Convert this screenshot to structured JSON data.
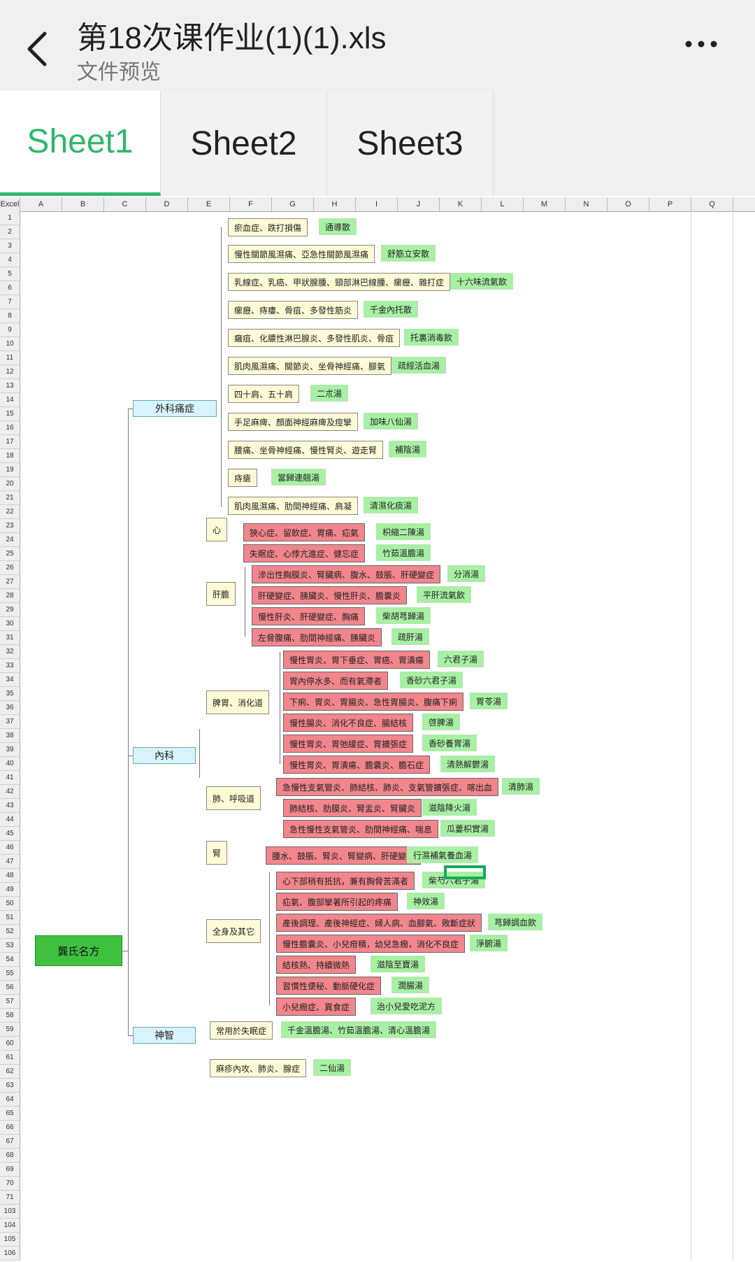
{
  "header": {
    "title": "第18次课作业(1)(1).xls",
    "subtitle": "文件预览"
  },
  "tabs": [
    "Sheet1",
    "Sheet2",
    "Sheet3"
  ],
  "active_tab": 0,
  "grid": {
    "corner": "Excel",
    "columns": [
      "A",
      "B",
      "C",
      "D",
      "E",
      "F",
      "G",
      "H",
      "I",
      "J",
      "K",
      "L",
      "M",
      "N",
      "O",
      "P",
      "Q"
    ],
    "rows": [
      "1",
      "2",
      "3",
      "4",
      "5",
      "6",
      "7",
      "8",
      "9",
      "10",
      "11",
      "12",
      "13",
      "14",
      "15",
      "16",
      "17",
      "18",
      "19",
      "20",
      "21",
      "22",
      "23",
      "24",
      "25",
      "26",
      "27",
      "28",
      "29",
      "30",
      "31",
      "32",
      "33",
      "34",
      "35",
      "36",
      "37",
      "38",
      "39",
      "40",
      "41",
      "42",
      "43",
      "44",
      "45",
      "46",
      "47",
      "48",
      "49",
      "50",
      "51",
      "52",
      "53",
      "54",
      "55",
      "56",
      "57",
      "58",
      "59",
      "60",
      "61",
      "62",
      "63",
      "64",
      "65",
      "66",
      "67",
      "68",
      "69",
      "70",
      "71",
      "103",
      "104",
      "105",
      "106"
    ]
  },
  "mindmap": {
    "root": "龔氏名方",
    "categories": [
      "外科痛症",
      "內科",
      "神智"
    ],
    "subgroups": [
      "心",
      "肝膽",
      "脾胃、消化道",
      "肺、呼吸道",
      "腎",
      "全身及其它"
    ],
    "symptoms": [
      "瘀血症、跌打損傷",
      "慢性關節風濕痛、亞急性關節風濕痛",
      "乳線症、乳癌、甲狀腺腫、頸部淋巴線腫、瘰癧、雜打症",
      "瘰癧、痔瘻、骨疽、多發性筋炎",
      "癰疽、化膿性淋巴腺炎、多發性肌炎、骨疽",
      "肌肉風濕痛、關節炎、坐骨神經痛、腳氣",
      "四十肩、五十肩",
      "手足麻痺、顏面神經麻痺及痙攣",
      "腰痛、坐骨神經痛、慢性腎炎、遊走腎",
      "痔瘡",
      "肌肉風濕痛、肋間神經痛、肩凝",
      "狹心症、留飲症、胃痛、疝氣",
      "失眠症、心悸亢進症、健忘症",
      "滲出性胸膜炎、腎臟病、腹水、鼓脹、肝硬變症",
      "肝硬變症、胰臟炎、慢性肝炎、膽囊炎",
      "慢性肝炎、肝硬變症、胸痛",
      "左脅腹痛、肋間神經痛、胰臟炎",
      "慢性胃炎、胃下垂症、胃癌、胃潰瘍",
      "胃內停水多、而有氣滯者",
      "下痢、胃炎、胃腸炎、急性胃腸炎、腹痛下痢",
      "慢性腸炎、消化不良症、腸結核",
      "慢性胃炎、胃弛緩症、胃擴張症",
      "慢性胃炎、胃潰瘍、膽囊炎、膽石症",
      "急慢性支氣管炎、肺結核、肺炎、支氣管擴張症、喀出血",
      "肺結核、肋膜炎、腎盂炎、腎臟炎",
      "急性慢性支氣管炎、肋間神經痛、喘息",
      "腫水、鼓脹、腎炎、腎變病、肝硬變症",
      "心下部稍有抵抗，兼有胸脅苦滿者",
      "疝氣、腹部攣著所引起的疼痛",
      "產後調理、產後神經症、婦人病、血腳氣、敗斷症狀",
      "慢性膽囊炎、小兒疳積，幼兒急癇，消化不良症",
      "結核熱、持續微熱",
      "習慣性便秘、動脈硬化症",
      "小兒癇症、異食症",
      "常用於失眠症",
      "麻疹內攻、肺炎、腺症"
    ],
    "formulas": [
      "通導散",
      "舒筋立安散",
      "十六味流氣飲",
      "千金內托散",
      "托裏消毒飲",
      "疏經活血湯",
      "二朮湯",
      "加味八仙湯",
      "補陰湯",
      "當歸連翹湯",
      "清濕化痰湯",
      "枳縮二陳湯",
      "竹茹溫膽湯",
      "分消湯",
      "平肝流氣飲",
      "柴胡芎歸湯",
      "疏肝湯",
      "六君子湯",
      "香砂六君子湯",
      "胃苓湯",
      "啓脾湯",
      "香砂養胃湯",
      "清熱解鬱湯",
      "清肺湯",
      "滋陰降火湯",
      "瓜蔞枳實湯",
      "行濕補氣養血湯",
      "柴芍六君子湯",
      "神效湯",
      "芎歸調血飲",
      "淨腑湯",
      "滋陰至寶湯",
      "潤腸湯",
      "治小兒愛吃泥方",
      "千金溫膽湯、竹茹溫膽湯、清心溫膽湯",
      "二仙湯"
    ]
  },
  "colors": {
    "accent": "#2eb86b",
    "root_fill": "#3fc13f",
    "category_fill": "#d8f3fb",
    "group_fill": "#fffbd6",
    "symptom_fill": "#f2868d",
    "formula_fill": "#a8f0a4"
  },
  "icons": {
    "back": "chevron-left-icon",
    "more": "more-dots-icon"
  }
}
